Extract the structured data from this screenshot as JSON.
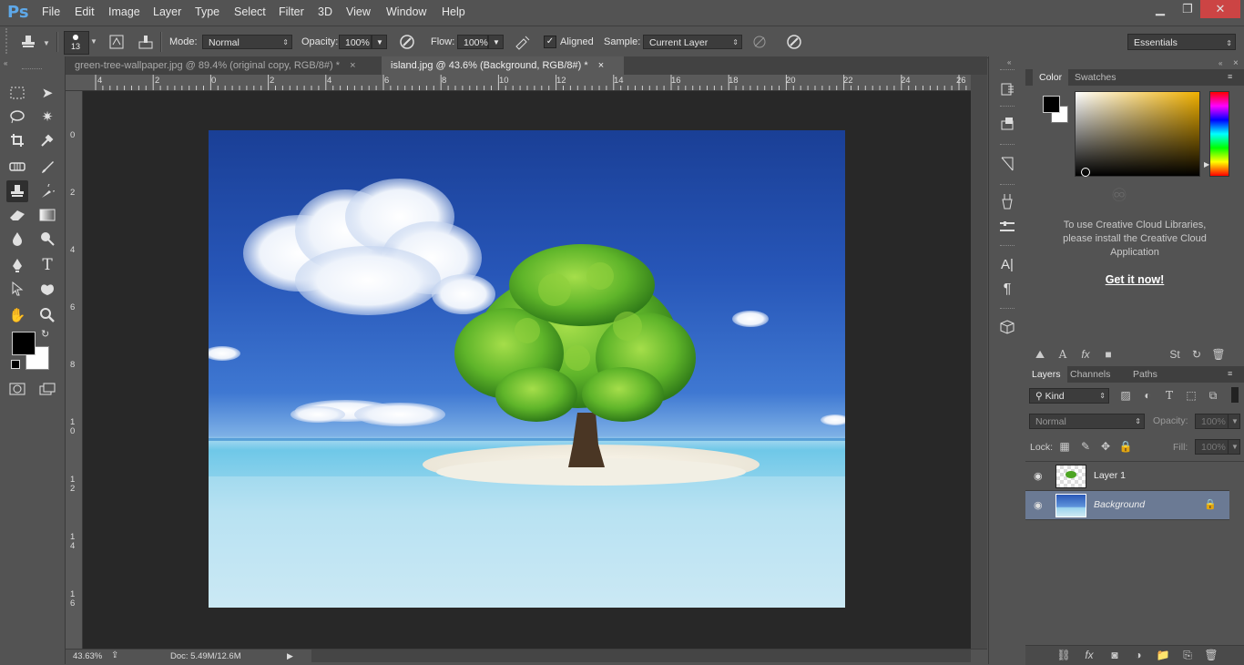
{
  "app": {
    "logo": "Ps"
  },
  "menu": [
    "File",
    "Edit",
    "Image",
    "Layer",
    "Type",
    "Select",
    "Filter",
    "3D",
    "View",
    "Window",
    "Help"
  ],
  "window_controls": {
    "minimize": "▁",
    "restore": "❐",
    "close": "✕"
  },
  "options": {
    "brush_size": "13",
    "mode_label": "Mode:",
    "mode_value": "Normal",
    "opacity_label": "Opacity:",
    "opacity_value": "100%",
    "flow_label": "Flow:",
    "flow_value": "100%",
    "aligned_label": "Aligned",
    "sample_label": "Sample:",
    "sample_value": "Current Layer",
    "workspace": "Essentials"
  },
  "tabs": [
    {
      "label": "green-tree-wallpaper.jpg @ 89.4% (original copy, RGB/8#) *",
      "active": false
    },
    {
      "label": "island.jpg @ 43.6% (Background, RGB/8#) *",
      "active": true
    }
  ],
  "ruler_h": [
    "4",
    "2",
    "0",
    "2",
    "4",
    "6",
    "8",
    "10",
    "12",
    "14",
    "16",
    "18",
    "20",
    "22",
    "24",
    "26"
  ],
  "ruler_v": [
    "0",
    "2",
    "4",
    "6",
    "8",
    "1 0",
    "1 2",
    "1 4",
    "1 6"
  ],
  "status": {
    "zoom": "43.63%",
    "doc": "Doc: 5.49M/12.6M"
  },
  "color_panel": {
    "tabs": [
      "Color",
      "Swatches"
    ],
    "foreground": "#000000",
    "background": "#ffffff",
    "hue_color": "#f0b000"
  },
  "libraries": {
    "message": "To use Creative Cloud Libraries, please install the Creative Cloud Application",
    "link": "Get it now!"
  },
  "layers_panel": {
    "tabs": [
      "Layers",
      "Channels",
      "Paths"
    ],
    "filter_kind": "Kind",
    "blend_mode": "Normal",
    "opacity_label": "Opacity:",
    "opacity_value": "100%",
    "lock_label": "Lock:",
    "fill_label": "Fill:",
    "fill_value": "100%",
    "layers": [
      {
        "name": "Layer 1",
        "selected": false,
        "locked": false
      },
      {
        "name": "Background",
        "selected": true,
        "locked": true
      }
    ]
  },
  "icons": {
    "stamp": "clone-stamp-icon",
    "lock": "🔒",
    "eye": "👁"
  }
}
